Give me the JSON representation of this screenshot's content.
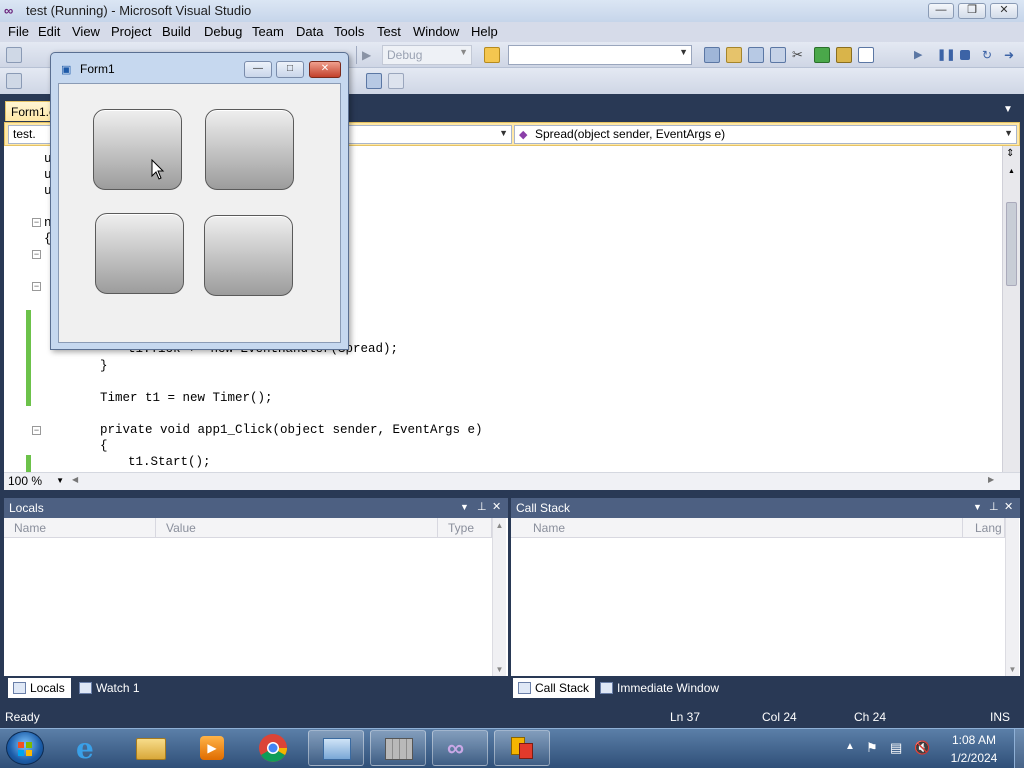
{
  "window": {
    "title": "test (Running) - Microsoft Visual Studio",
    "minimize_glyph": "—",
    "restore_glyph": "❐",
    "close_glyph": "✕"
  },
  "menu": [
    "File",
    "Edit",
    "View",
    "Project",
    "Build",
    "Debug",
    "Team",
    "Data",
    "Tools",
    "Test",
    "Window",
    "Help"
  ],
  "toolbar": {
    "config": "Debug",
    "search_value": ""
  },
  "doc_tab": {
    "label": "Form1.cs"
  },
  "navbar": {
    "class_combo": "test.",
    "member_combo": "Spread(object sender, EventArgs e)"
  },
  "editor": {
    "line_using1": "u",
    "line_using2": "u",
    "line_using3": "u",
    "line_ns": "n",
    "line_brace_open": "{",
    "line_tick": "t1.Tick += new EventHandler(Spread);",
    "line_close": "}",
    "line_timer": "Timer t1 = new Timer();",
    "line_method": "private void app1_Click(object sender, EventArgs e)",
    "line_method_open": "{",
    "line_start": "t1.Start();",
    "zoom": "100 %"
  },
  "form1": {
    "title": "Form1"
  },
  "locals": {
    "title": "Locals",
    "columns": [
      "Name",
      "Value",
      "Type"
    ]
  },
  "callstack": {
    "title": "Call Stack",
    "columns": [
      "Name",
      "Lang"
    ]
  },
  "bottom_tabs_left": [
    "Locals",
    "Watch 1"
  ],
  "bottom_tabs_right": [
    "Call Stack",
    "Immediate Window"
  ],
  "status": {
    "text": "Ready",
    "ln": "Ln 37",
    "col": "Col 24",
    "ch": "Ch 24",
    "mode": "INS"
  },
  "taskbar": {
    "time": "1:08 AM",
    "date": "1/2/2024"
  },
  "colors": {
    "vs_purple": "#68217a",
    "dark_chrome": "#293955",
    "tab_yellow": "#ffe8a6",
    "change_green": "#6cc24a"
  }
}
